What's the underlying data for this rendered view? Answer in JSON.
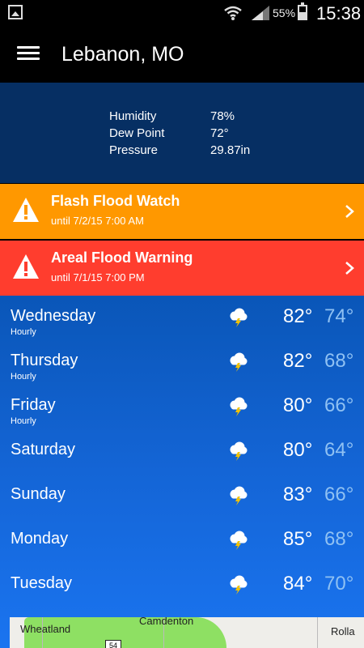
{
  "status_bar": {
    "battery_percent": "55%",
    "battery_level": 0.55,
    "time": "15:38"
  },
  "header": {
    "location": "Lebanon, MO"
  },
  "conditions": [
    {
      "label": "Humidity",
      "value": "78%"
    },
    {
      "label": "Dew Point",
      "value": "72°"
    },
    {
      "label": "Pressure",
      "value": "29.87in"
    }
  ],
  "alerts": [
    {
      "title": "Flash Flood Watch",
      "until": "until 7/2/15 7:00 AM",
      "color": "#ff9800"
    },
    {
      "title": "Areal Flood Warning",
      "until": "until 7/1/15 7:00 PM",
      "color": "#ff3d2e"
    }
  ],
  "forecast": [
    {
      "day": "Wednesday",
      "hourly": "Hourly",
      "icon": "thunderstorm-icon",
      "high": "82°",
      "low": "74°"
    },
    {
      "day": "Thursday",
      "hourly": "Hourly",
      "icon": "thunderstorm-icon",
      "high": "82°",
      "low": "68°"
    },
    {
      "day": "Friday",
      "hourly": "Hourly",
      "icon": "thunderstorm-icon",
      "high": "80°",
      "low": "66°"
    },
    {
      "day": "Saturday",
      "hourly": "",
      "icon": "thunderstorm-icon",
      "high": "80°",
      "low": "64°"
    },
    {
      "day": "Sunday",
      "hourly": "",
      "icon": "thunderstorm-icon",
      "high": "83°",
      "low": "66°"
    },
    {
      "day": "Monday",
      "hourly": "",
      "icon": "thunderstorm-icon",
      "high": "85°",
      "low": "68°"
    },
    {
      "day": "Tuesday",
      "hourly": "",
      "icon": "thunderstorm-icon",
      "high": "84°",
      "low": "70°"
    }
  ],
  "map": {
    "labels": [
      "Wheatland",
      "Camdenton",
      "Rolla"
    ],
    "route": "54"
  },
  "colors": {
    "conditions_bg": "#062f63",
    "forecast_bg": "#1465d6",
    "low_temp": "#8fc1f3"
  }
}
